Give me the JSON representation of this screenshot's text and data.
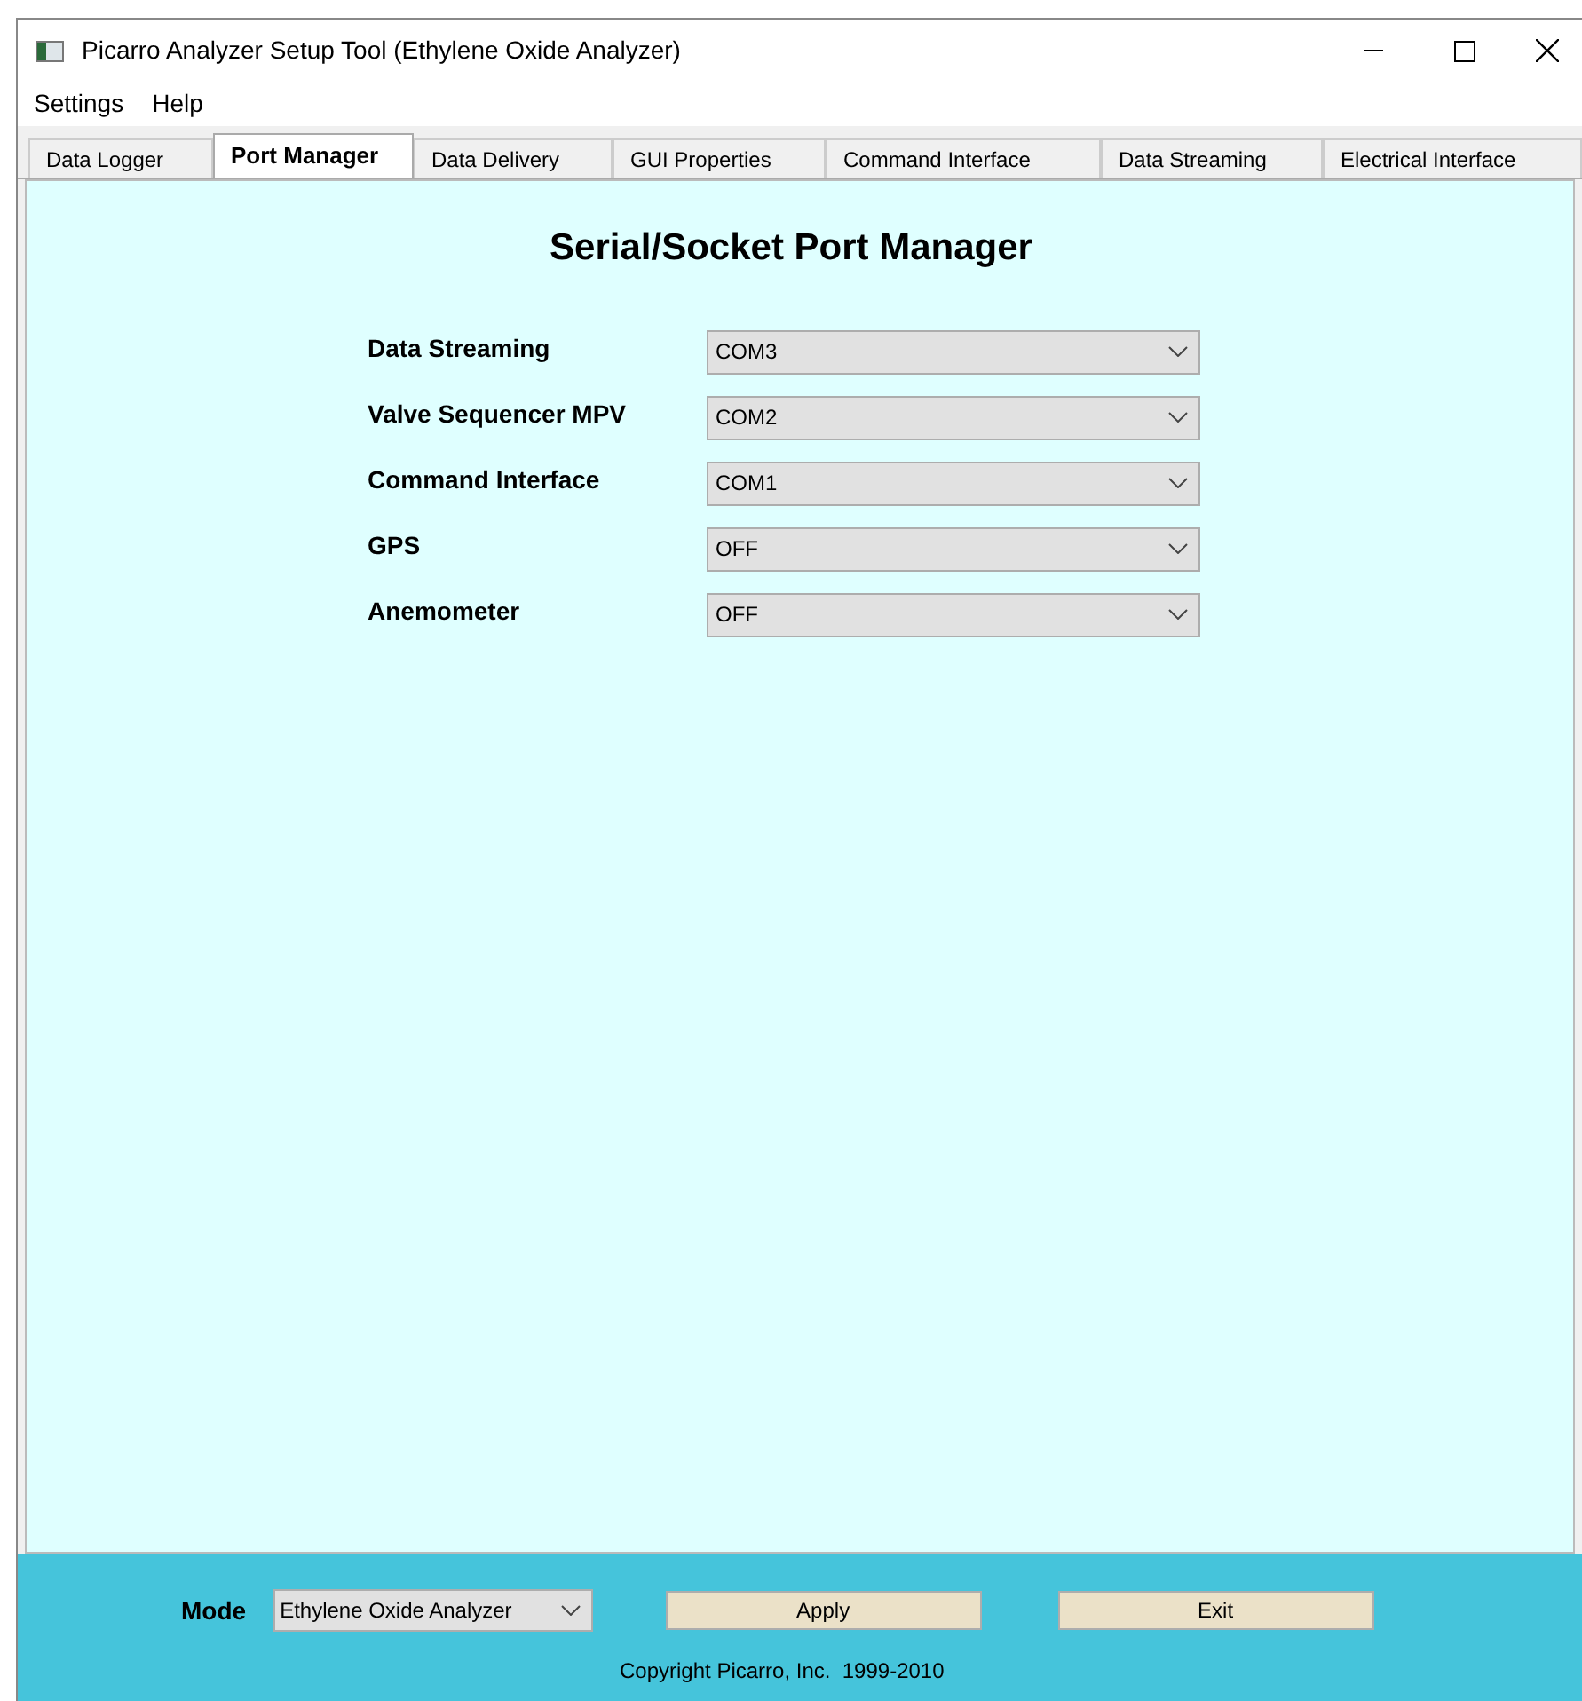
{
  "window": {
    "title": "Picarro Analyzer Setup Tool (Ethylene Oxide Analyzer)"
  },
  "menu": [
    "Settings",
    "Help"
  ],
  "tabs": [
    {
      "label": "Data Logger",
      "selected": false
    },
    {
      "label": "Port Manager",
      "selected": true
    },
    {
      "label": "Data Delivery",
      "selected": false
    },
    {
      "label": "GUI Properties",
      "selected": false
    },
    {
      "label": "Command Interface",
      "selected": false
    },
    {
      "label": "Data Streaming",
      "selected": false
    },
    {
      "label": "Electrical Interface",
      "selected": false
    }
  ],
  "heading": "Serial/Socket Port Manager",
  "ports": [
    {
      "label": "Data Streaming",
      "value": "COM3"
    },
    {
      "label": "Valve Sequencer MPV",
      "value": "COM2"
    },
    {
      "label": "Command Interface",
      "value": "COM1"
    },
    {
      "label": "GPS",
      "value": "OFF"
    },
    {
      "label": "Anemometer",
      "value": "OFF"
    }
  ],
  "footer": {
    "mode_label": "Mode",
    "mode_value": "Ethylene Oxide Analyzer",
    "buttons": [
      "Apply",
      "Exit"
    ],
    "copyright": "Copyright Picarro, Inc.  1999-2010"
  }
}
